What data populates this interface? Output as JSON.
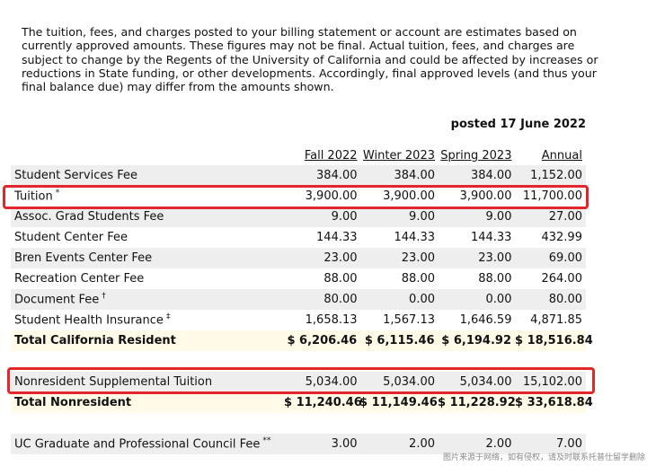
{
  "notice": {
    "lines": [
      "The tuition, fees, and charges posted to your billing statement or account are estimates based on",
      "currently approved amounts. These figures may not be final. Actual tuition, fees, and charges are",
      "subject to change by the Regents of the University of California and could be affected by increases or",
      "reductions in State funding, or other developments. Accordingly, final approved levels (and thus your",
      "final balance due) may differ from the amounts shown."
    ]
  },
  "posted": "posted 17 June 2022",
  "columns": [
    "Fall 2022",
    "Winter 2023",
    "Spring 2023",
    "Annual"
  ],
  "rows": [
    {
      "name": "Student Services Fee",
      "mark": "",
      "values": [
        "384.00",
        "384.00",
        "384.00",
        "1,152.00"
      ]
    },
    {
      "name": "Tuition",
      "mark": "*",
      "values": [
        "3,900.00",
        "3,900.00",
        "3,900.00",
        "11,700.00"
      ]
    },
    {
      "name": "Assoc. Grad Students Fee",
      "mark": "",
      "values": [
        "9.00",
        "9.00",
        "9.00",
        "27.00"
      ]
    },
    {
      "name": "Student Center Fee",
      "mark": "",
      "values": [
        "144.33",
        "144.33",
        "144.33",
        "432.99"
      ]
    },
    {
      "name": "Bren Events Center Fee",
      "mark": "",
      "values": [
        "23.00",
        "23.00",
        "23.00",
        "69.00"
      ]
    },
    {
      "name": "Recreation Center Fee",
      "mark": "",
      "values": [
        "88.00",
        "88.00",
        "88.00",
        "264.00"
      ]
    },
    {
      "name": "Document Fee",
      "mark": "†",
      "values": [
        "80.00",
        "0.00",
        "0.00",
        "80.00"
      ]
    },
    {
      "name": "Student Health Insurance",
      "mark": "‡",
      "values": [
        "1,658.13",
        "1,567.13",
        "1,646.59",
        "4,871.85"
      ]
    }
  ],
  "total_resident": {
    "name": "Total California Resident",
    "values": [
      "$ 6,206.46",
      "$ 6,115.46",
      "$ 6,194.92",
      "$ 18,516.84"
    ]
  },
  "nonresident_row": {
    "name": "Nonresident Supplemental Tuition",
    "values": [
      "5,034.00",
      "5,034.00",
      "5,034.00",
      "15,102.00"
    ]
  },
  "total_nonresident": {
    "name": "Total Nonresident",
    "values": [
      "$ 11,240.46",
      "$ 11,149.46",
      "$ 11,228.92",
      "$ 33,618.84"
    ]
  },
  "council_row": {
    "name": "UC Graduate and Professional Council Fee",
    "mark": "**",
    "values": [
      "3.00",
      "2.00",
      "2.00",
      "7.00"
    ]
  },
  "watermark": "图片来源于网络，如有侵权，请及时联系托普仕留学删除",
  "colors": {
    "highlight": "#e3262b",
    "shaded_row": "#eeeeee",
    "total_row": "#fffbe8"
  }
}
